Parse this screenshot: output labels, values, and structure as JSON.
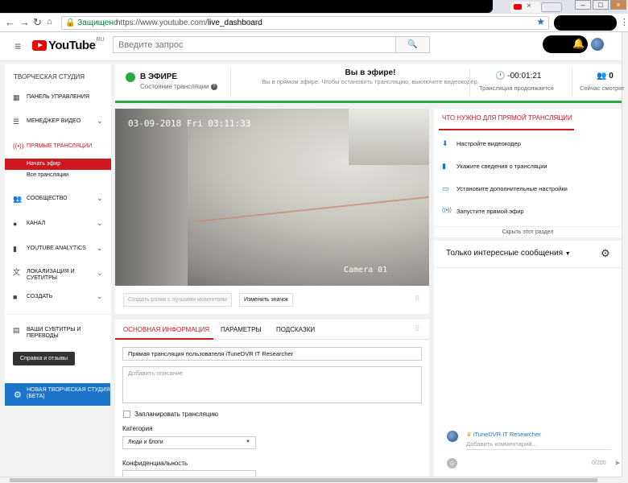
{
  "browser": {
    "url_prefix": "https://www.youtube.com/",
    "url_path": "live_dashboard",
    "secure_label": "Защищено"
  },
  "header": {
    "logo_text": "YouTube",
    "logo_region": "RU",
    "search_placeholder": "Введите запрос"
  },
  "sidebar": {
    "title": "ТВОРЧЕСКАЯ СТУДИЯ",
    "items": [
      {
        "label": "ПАНЕЛЬ УПРАВЛЕНИЯ",
        "icon": "dashboard-icon"
      },
      {
        "label": "МЕНЕДЖЕР ВИДЕО",
        "icon": "video-manager-icon"
      },
      {
        "label": "ПРЯМЫЕ ТРАНСЛЯЦИИ",
        "icon": "live-icon"
      },
      {
        "label": "СООБЩЕСТВО",
        "icon": "community-icon"
      },
      {
        "label": "КАНАЛ",
        "icon": "channel-icon"
      },
      {
        "label": "YOUTUBE ANALYTICS",
        "icon": "analytics-icon"
      },
      {
        "label": "ЛОКАЛИЗАЦИЯ И СУБТИТРЫ",
        "icon": "translate-icon"
      },
      {
        "label": "СОЗДАТЬ",
        "icon": "create-icon"
      },
      {
        "label": "ВАШИ СУБТИТРЫ И ПЕРЕВОДЫ",
        "icon": "subtitles-icon"
      }
    ],
    "sub_items": [
      "Начать эфир",
      "Все трансляции"
    ],
    "feedback": "Справка и отзывы",
    "beta": "НОВАЯ ТВОРЧЕСКАЯ СТУДИЯ (БЕТА)"
  },
  "status": {
    "live_title": "В ЭФИРЕ",
    "live_sub": "Состояние трансляции",
    "msg_title": "Вы в эфире!",
    "msg_sub": "Вы в прямом эфире. Чтобы остановить трансляцию, выключите видеокодер.",
    "timer": "-00:01:21",
    "timer_sub": "Трансляция продолжается",
    "viewers": "0",
    "viewers_sub": "Сейчас смотрят"
  },
  "video": {
    "timestamp": "03-09-2018 Fri 03:11:33",
    "camera": "Camera 01",
    "btn_highlights": "Создать ролик с лучшими моментами",
    "btn_thumbnail": "Изменить значок"
  },
  "info": {
    "tabs": [
      "ОСНОВНАЯ ИНФОРМАЦИЯ",
      "ПАРАМЕТРЫ",
      "ПОДСКАЗКИ"
    ],
    "title_value": "Прямая трансляция пользователя iTuneDVR IT Researcher",
    "desc_placeholder": "Добавить описание",
    "schedule_label": "Запланировать трансляцию",
    "category_label": "Категория",
    "category_value": "Люди и блоги",
    "privacy_label": "Конфиденциальность"
  },
  "tips": {
    "title": "ЧТО НУЖНО ДЛЯ ПРЯМОЙ ТРАНСЛЯЦИИ",
    "items": [
      "Настройте видеокодер",
      "Укажите сведения о трансляции",
      "Установите дополнительные настройки",
      "Запустите прямой эфир"
    ],
    "hide": "Скрыть этот раздел"
  },
  "chat": {
    "filter": "Только интересные сообщения",
    "user": "iTuneDVR IT Researcher",
    "placeholder": "Добавить комментарий...",
    "counter": "0/200"
  },
  "colors": {
    "brand_red": "#cc181e",
    "live_green": "#2ba640",
    "beta_blue": "#1a73c8"
  }
}
